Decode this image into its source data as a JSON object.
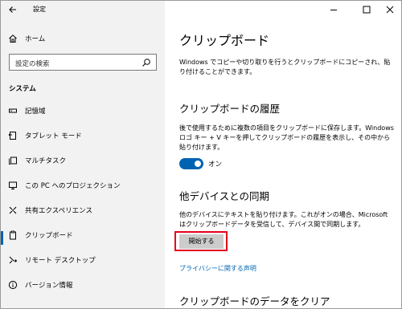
{
  "app": {
    "title": "設定"
  },
  "sidebar": {
    "home_label": "ホーム",
    "search_placeholder": "設定の検索",
    "section_title": "システム",
    "items": [
      {
        "label": "記憶域",
        "icon": "storage-icon"
      },
      {
        "label": "タブレット モード",
        "icon": "tablet-mode-icon"
      },
      {
        "label": "マルチタスク",
        "icon": "multitasking-icon"
      },
      {
        "label": "この PC へのプロジェクション",
        "icon": "projection-icon"
      },
      {
        "label": "共有エクスペリエンス",
        "icon": "shared-experiences-icon"
      },
      {
        "label": "クリップボード",
        "icon": "clipboard-icon",
        "selected": true
      },
      {
        "label": "リモート デスクトップ",
        "icon": "remote-desktop-icon"
      },
      {
        "label": "バージョン情報",
        "icon": "about-icon"
      }
    ]
  },
  "main": {
    "title": "クリップボード",
    "intro": "Windows でコピーや切り取りを行うとクリップボードにコピーされ、貼り付けることができます。",
    "history": {
      "heading": "クリップボードの履歴",
      "description": "後で使用するために複数の項目をクリップボードに保存します。Windows ロゴ キー + V キーを押してクリップボードの履歴を表示し、その中から貼り付けます。",
      "toggle_state": "オン",
      "toggle_on": true
    },
    "sync": {
      "heading": "他デバイスとの同期",
      "description": "他のデバイスにテキストを貼り付けます。これがオンの場合、Microsoft はクリップボードデータを受信して、デバイス間で同期します。",
      "button_label": "開始する"
    },
    "privacy_link": "プライバシーに関する声明",
    "clear_heading": "クリップボードのデータをクリア"
  },
  "colors": {
    "accent": "#0063b1",
    "highlight": "#e4001a",
    "sidebar_bg": "#f2f2f2"
  }
}
